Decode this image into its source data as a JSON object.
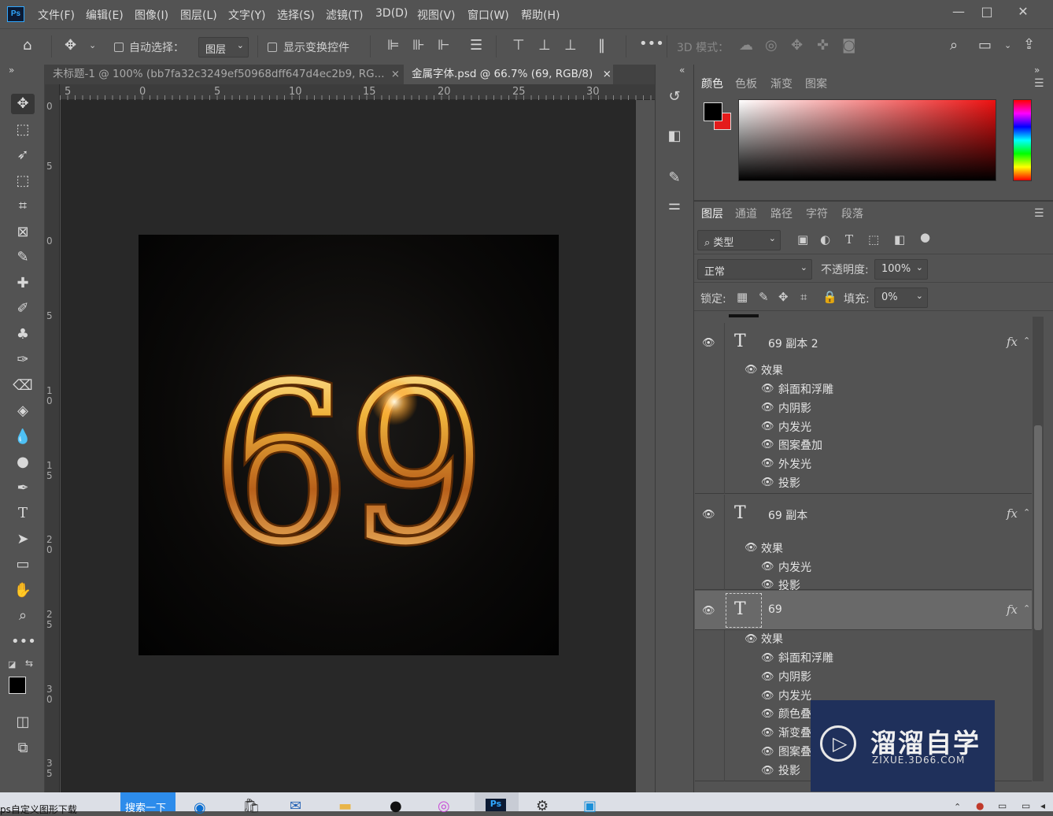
{
  "app": {
    "logo": "Ps"
  },
  "menu": [
    "文件(F)",
    "编辑(E)",
    "图像(I)",
    "图层(L)",
    "文字(Y)",
    "选择(S)",
    "滤镜(T)",
    "3D(D)",
    "视图(V)",
    "窗口(W)",
    "帮助(H)"
  ],
  "window_controls": {
    "minimize": "—",
    "maximize": "□",
    "close": "✕"
  },
  "options": {
    "auto_select_label": "自动选择：",
    "auto_select_value": "图层",
    "show_transform_label": "显示变换控件",
    "mode_3d_label": "3D 模式："
  },
  "tabs": [
    {
      "label": "未标题-1 @ 100% (bb7fa32c3249ef50968dff647d4ec2b9, RG...",
      "close": "×"
    },
    {
      "label": "金属字体.psd @ 66.7% (69, RGB/8)",
      "close": "×"
    }
  ],
  "ruler_top": [
    "5",
    "0",
    "5",
    "10",
    "15",
    "20",
    "25",
    "30"
  ],
  "ruler_left": [
    "0",
    "5",
    "0",
    "5",
    "1 0",
    "1 5",
    "2 0",
    "2 5",
    "3 0",
    "3 5"
  ],
  "canvas": {
    "text": "69"
  },
  "color_panel": {
    "tabs": [
      "颜色",
      "色板",
      "渐变",
      "图案"
    ],
    "fg": "#000000",
    "bg": "#e41b1b"
  },
  "layers_panel": {
    "tabs": [
      "图层",
      "通道",
      "路径",
      "字符",
      "段落"
    ],
    "filter_label": "类型",
    "blend_mode": "正常",
    "opacity_label": "不透明度:",
    "opacity_value": "100%",
    "lock_label": "锁定:",
    "fill_label": "填充:",
    "fill_value": "0%",
    "layers": [
      {
        "name": "69 副本 2",
        "effects_label": "效果",
        "effects": [
          "斜面和浮雕",
          "内阴影",
          "内发光",
          "图案叠加",
          "外发光",
          "投影"
        ]
      },
      {
        "name": "69 副本",
        "effects_label": "效果",
        "effects": [
          "内发光",
          "投影"
        ]
      },
      {
        "name": "69",
        "effects_label": "效果",
        "effects": [
          "斜面和浮雕",
          "内阴影",
          "内发光",
          "颜色叠",
          "渐变叠",
          "图案叠",
          "投影"
        ]
      }
    ],
    "fx_label": "fx"
  },
  "watermark": {
    "title": "溜溜自学",
    "url": "ZIXUE.3D66.COM"
  },
  "taskbar": {
    "left_text": "ps自定义图形下载",
    "search_label": "搜索一下"
  }
}
